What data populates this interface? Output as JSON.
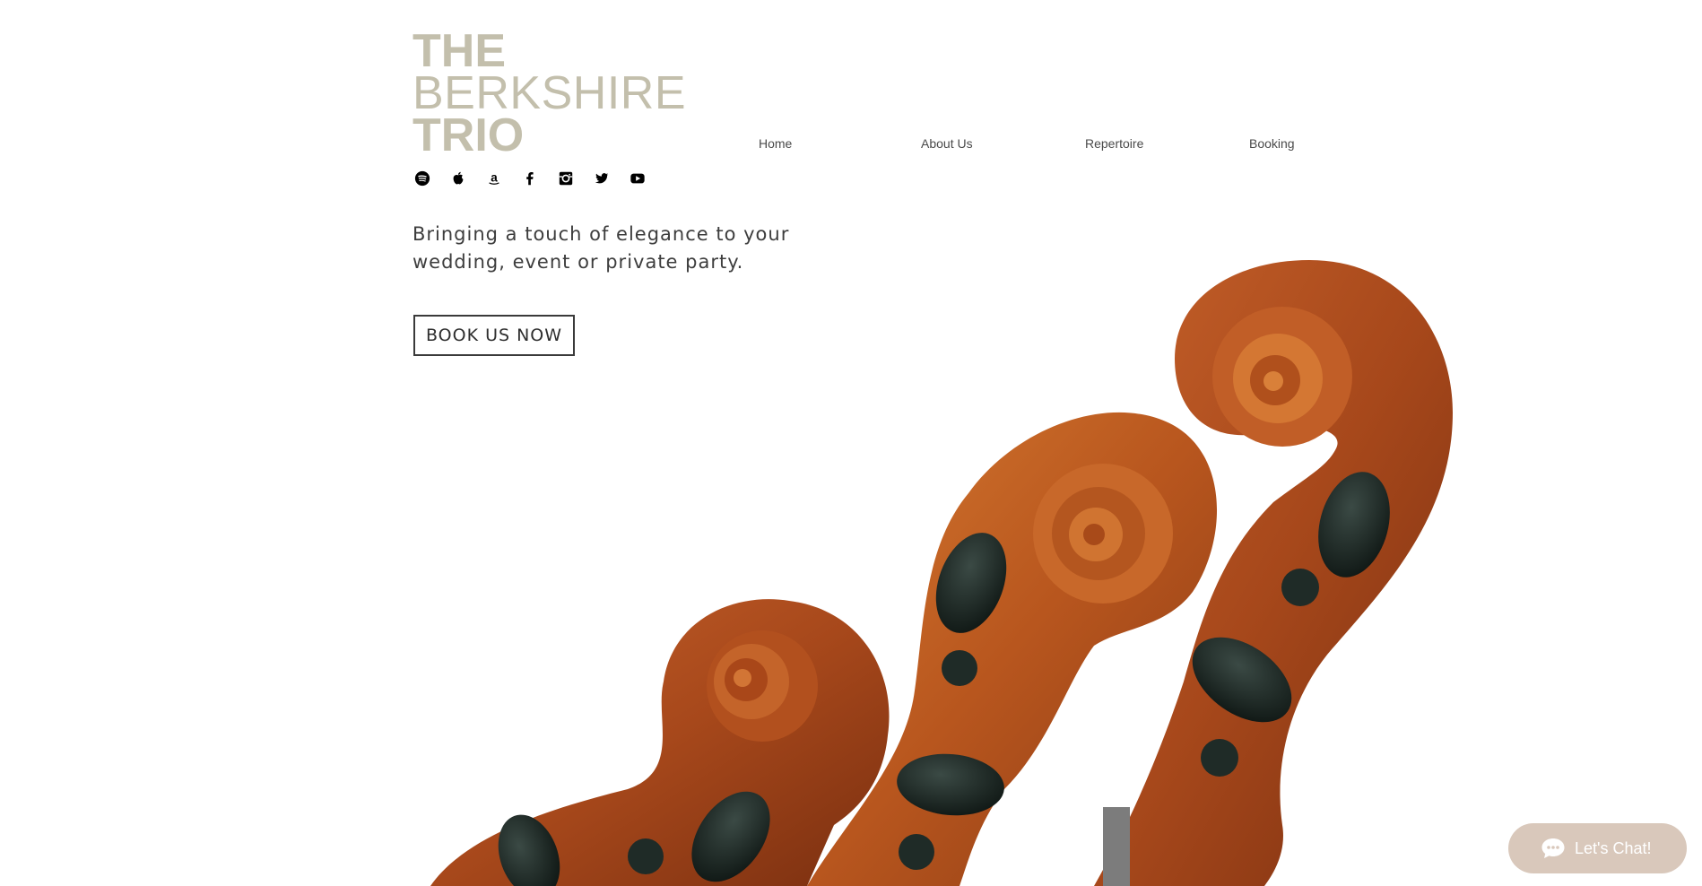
{
  "brand": {
    "line1": "THE",
    "line2": "BERKSHIRE",
    "line3": "TRIO"
  },
  "social": [
    {
      "icon": "spotify-icon"
    },
    {
      "icon": "apple-icon"
    },
    {
      "icon": "amazon-icon"
    },
    {
      "icon": "facebook-icon"
    },
    {
      "icon": "instagram-icon"
    },
    {
      "icon": "twitter-icon"
    },
    {
      "icon": "youtube-icon"
    }
  ],
  "nav": {
    "home": "Home",
    "about": "About Us",
    "repertoire": "Repertoire",
    "booking": "Booking"
  },
  "hero": {
    "tagline_line1": "Bringing a touch of elegance to your",
    "tagline_line2": "wedding, event or private party.",
    "cta": "BOOK US NOW"
  },
  "chat": {
    "label": "Let's Chat!"
  },
  "colors": {
    "brand": "#c3bfac",
    "chat_bg": "#d9c8bb",
    "wood_dark": "#8a3a16",
    "wood_light": "#c9642a",
    "peg": "#1e2a26"
  }
}
